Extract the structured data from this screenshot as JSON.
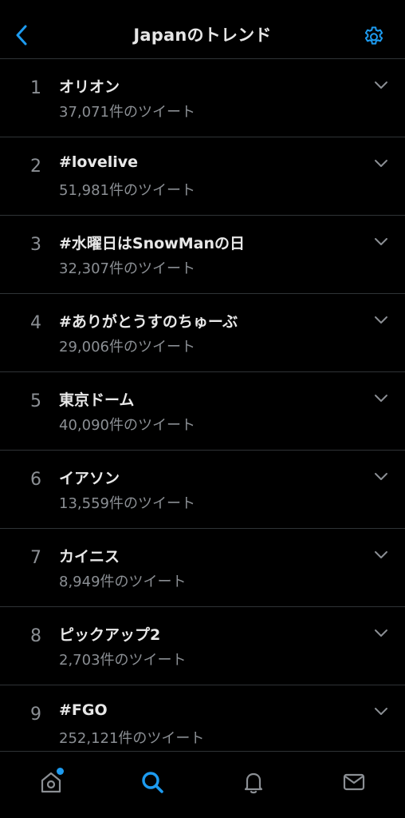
{
  "header": {
    "title": "Japanのトレンド",
    "back_icon": "chevron-left-icon",
    "settings_icon": "gear-icon"
  },
  "trends": [
    {
      "rank": "1",
      "name": "オリオン",
      "count": "37,071件のツイート"
    },
    {
      "rank": "2",
      "name": "#lovelive",
      "count": "51,981件のツイート"
    },
    {
      "rank": "3",
      "name": "#水曜日はSnowManの日",
      "count": "32,307件のツイート"
    },
    {
      "rank": "4",
      "name": "#ありがとうすのちゅーぶ",
      "count": "29,006件のツイート"
    },
    {
      "rank": "5",
      "name": "東京ドーム",
      "count": "40,090件のツイート"
    },
    {
      "rank": "6",
      "name": "イアソン",
      "count": "13,559件のツイート"
    },
    {
      "rank": "7",
      "name": "カイニス",
      "count": "8,949件のツイート"
    },
    {
      "rank": "8",
      "name": "ピックアップ2",
      "count": "2,703件のツイート"
    },
    {
      "rank": "9",
      "name": "#FGO",
      "count": "252,121件のツイート"
    }
  ],
  "tabbar": {
    "items": [
      "home-icon",
      "search-icon",
      "bell-icon",
      "mail-icon"
    ],
    "active": "search-icon"
  },
  "colors": {
    "accent": "#1d9bf0",
    "background": "#000000",
    "divider": "#2f3336",
    "primary_text": "#e8e8e8",
    "secondary_text": "#8b8f94"
  }
}
